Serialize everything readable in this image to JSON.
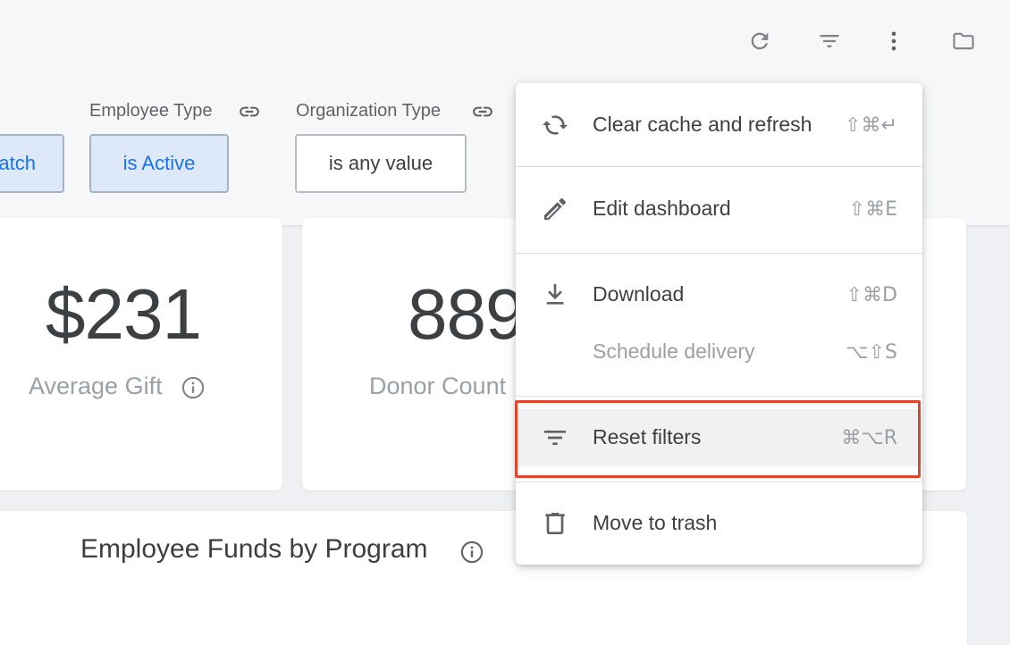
{
  "toolbar": {
    "icons": [
      "refresh-icon",
      "filter-icon",
      "more-vert-icon",
      "folder-icon"
    ]
  },
  "filters": [
    {
      "label": "",
      "value": "atch",
      "state": "active"
    },
    {
      "label": "Employee Type",
      "value": "is Active",
      "state": "active"
    },
    {
      "label": "Organization Type",
      "value": "is any value",
      "state": "plain"
    }
  ],
  "cards": {
    "average_gift": {
      "value": "$231",
      "label": "Average Gift"
    },
    "donor_count": {
      "value": "889",
      "label": "Donor Count"
    }
  },
  "chart": {
    "title": "Employee Funds by Program"
  },
  "menu": {
    "items": [
      {
        "label": "Clear cache and refresh",
        "shortcut": "⇧⌘↵",
        "icon": "refresh-icon",
        "disabled": false
      },
      {
        "label": "Edit dashboard",
        "shortcut": "⇧⌘E",
        "icon": "pencil-icon",
        "disabled": false
      },
      {
        "label": "Download",
        "shortcut": "⇧⌘D",
        "icon": "download-icon",
        "disabled": false
      },
      {
        "label": "Schedule delivery",
        "shortcut": "⌥⇧S",
        "icon": "",
        "disabled": true
      },
      {
        "label": "Reset filters",
        "shortcut": "⌘⌥R",
        "icon": "filter-icon",
        "disabled": false,
        "highlighted": true
      },
      {
        "label": "Move to trash",
        "shortcut": "",
        "icon": "trash-icon",
        "disabled": false
      }
    ]
  },
  "colors": {
    "accent": "#1a73e8",
    "highlight_border": "#e0452d",
    "chip_active_bg": "#dde8f8"
  }
}
